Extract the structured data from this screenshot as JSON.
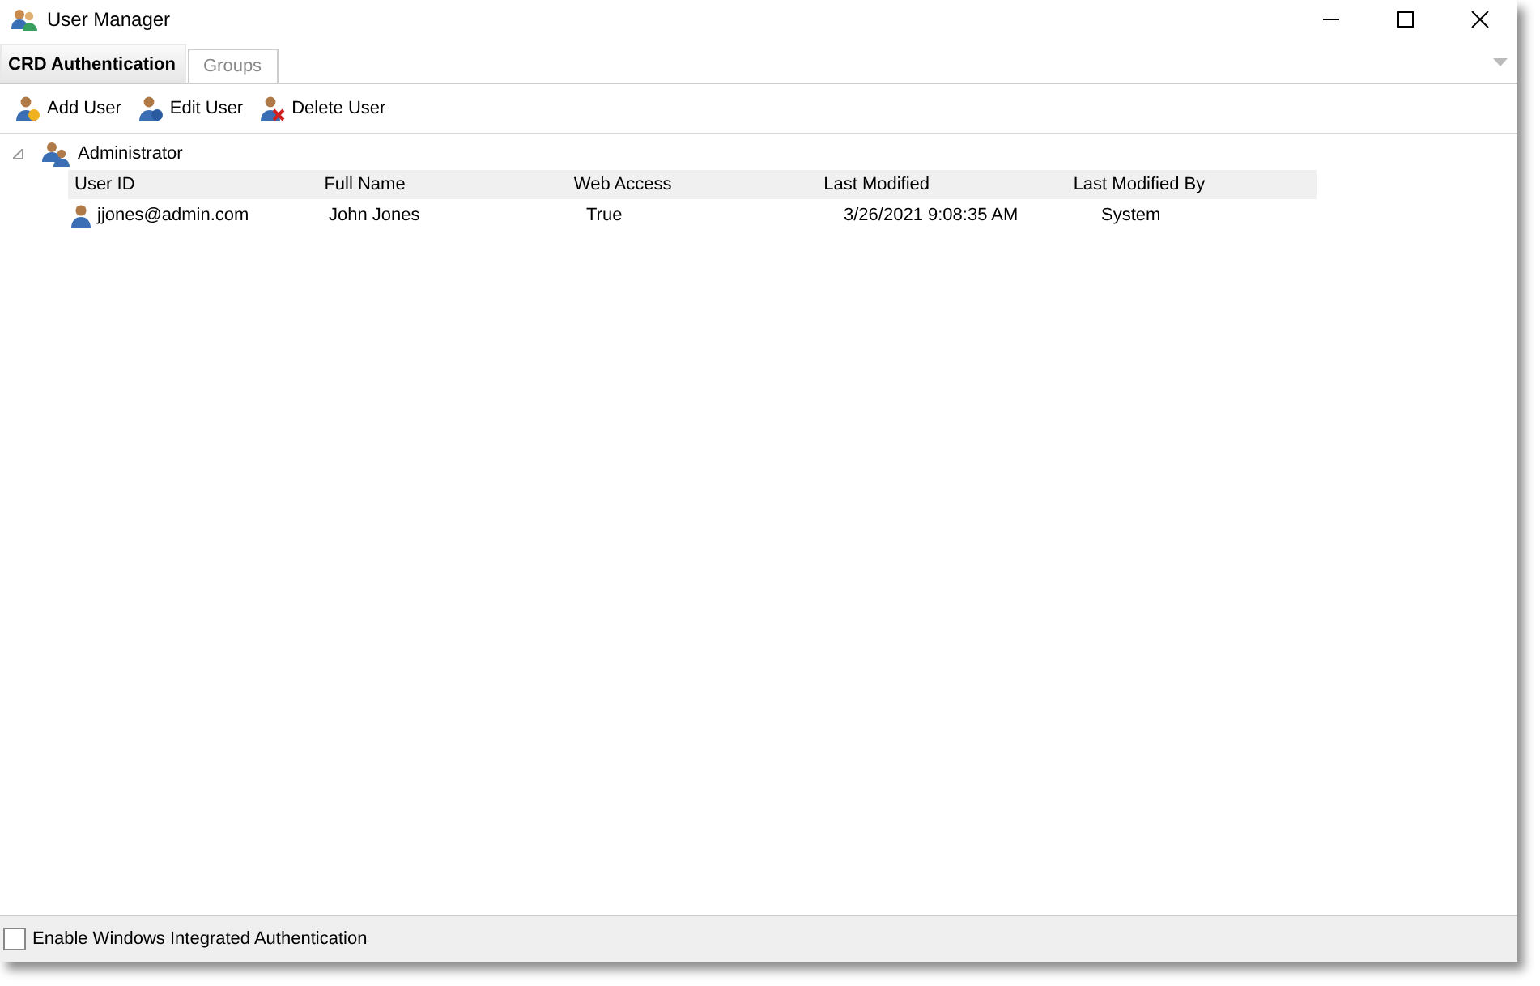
{
  "window": {
    "title": "User Manager"
  },
  "tabs": [
    {
      "label": "CRD Authentication",
      "selected": true
    },
    {
      "label": "Groups",
      "selected": false
    }
  ],
  "toolbar": [
    {
      "label": "Add User",
      "kind": "add"
    },
    {
      "label": "Edit User",
      "kind": "edit"
    },
    {
      "label": "Delete User",
      "kind": "delete"
    }
  ],
  "tree": {
    "group": "Administrator",
    "expanded": true,
    "columns": [
      "User ID",
      "Full Name",
      "Web Access",
      "Last Modified",
      "Last Modified By"
    ],
    "rows": [
      [
        "jjones@admin.com",
        "John Jones",
        "True",
        "3/26/2021 9:08:35 AM",
        "System"
      ]
    ]
  },
  "footer": {
    "checkbox": {
      "label": "Enable Windows Integrated Authentication",
      "checked": false
    }
  }
}
